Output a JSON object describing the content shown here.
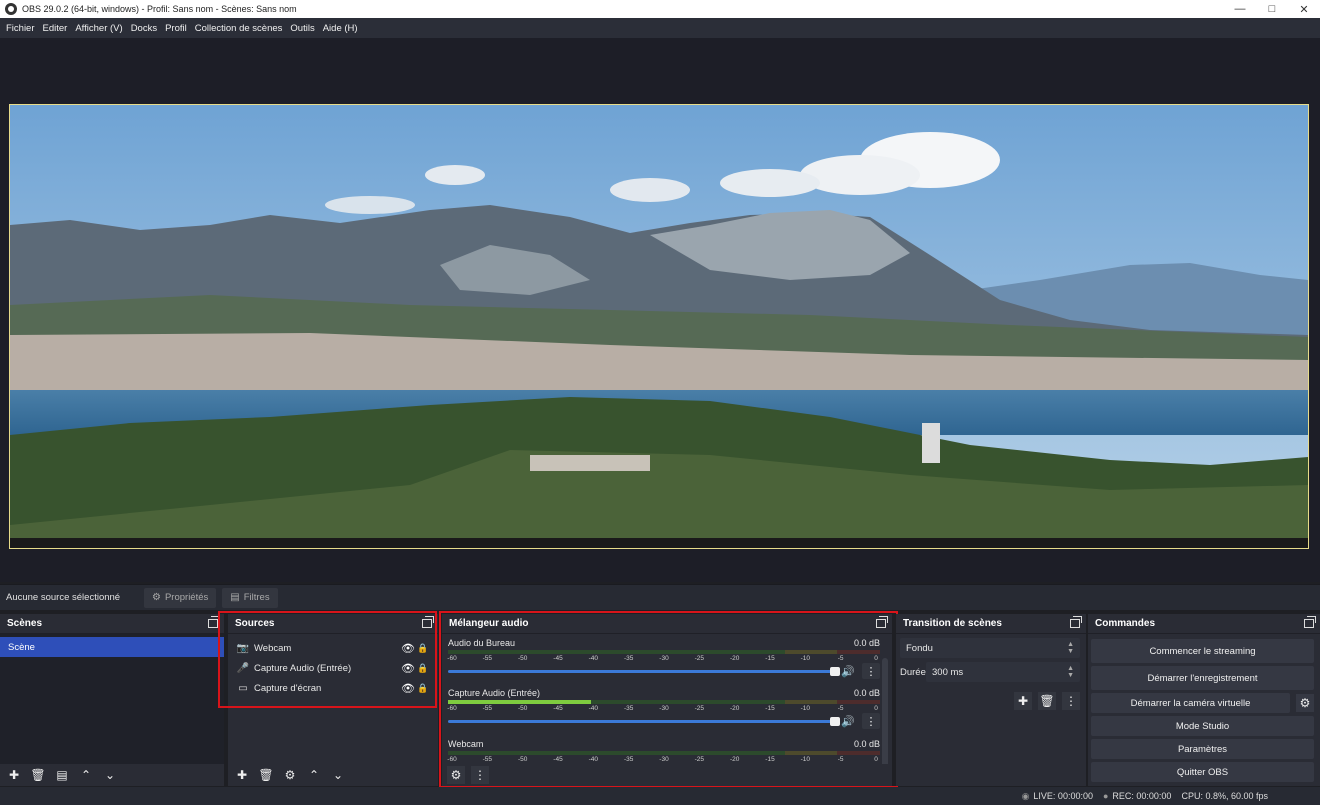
{
  "window": {
    "title": "OBS 29.0.2 (64-bit, windows) - Profil: Sans nom - Scènes: Sans nom",
    "app_icon": "obs-logo-icon",
    "controls": [
      "minimize-icon",
      "maximize-icon",
      "close-icon"
    ]
  },
  "menu": [
    "Fichier",
    "Editer",
    "Afficher (V)",
    "Docks",
    "Profil",
    "Collection de scènes",
    "Outils",
    "Aide (H)"
  ],
  "source_toolbar": {
    "no_source": "Aucune source sélectionné",
    "properties": "Propriétés",
    "filters": "Filtres"
  },
  "scenes": {
    "title": "Scènes",
    "items": [
      "Scène"
    ]
  },
  "sources": {
    "title": "Sources",
    "items": [
      {
        "name": "Webcam",
        "icon": "camera-icon"
      },
      {
        "name": "Capture Audio (Entrée)",
        "icon": "microphone-icon"
      },
      {
        "name": "Capture d'écran",
        "icon": "monitor-icon"
      }
    ]
  },
  "mixer": {
    "title": "Mélangeur audio",
    "ticks": [
      "-60",
      "-55",
      "-50",
      "-45",
      "-40",
      "-35",
      "-30",
      "-25",
      "-20",
      "-15",
      "-10",
      "-5",
      "0"
    ],
    "channels": [
      {
        "name": "Audio du Bureau",
        "db": "0.0 dB",
        "level": 0.0,
        "volume": 1.0
      },
      {
        "name": "Capture Audio (Entrée)",
        "db": "0.0 dB",
        "level": 0.33,
        "volume": 1.0
      },
      {
        "name": "Webcam",
        "db": "0.0 dB",
        "level": 0.0,
        "volume": 1.0
      }
    ]
  },
  "transition": {
    "title": "Transition de scènes",
    "type": "Fondu",
    "duration_label": "Durée",
    "duration_value": "300 ms"
  },
  "controls": {
    "title": "Commandes",
    "start_streaming": "Commencer le streaming",
    "start_recording": "Démarrer l'enregistrement",
    "start_virtual_cam": "Démarrer la caméra virtuelle",
    "studio_mode": "Mode Studio",
    "settings": "Paramètres",
    "exit": "Quitter OBS"
  },
  "status": {
    "live": "LIVE: 00:00:00",
    "rec": "REC: 00:00:00",
    "cpu": "CPU: 0.8%, 60.00 fps"
  },
  "colors": {
    "accent_selected": "#2e4fb9",
    "highlight_box": "#d8141a",
    "preview_border": "#e8dc8a"
  }
}
